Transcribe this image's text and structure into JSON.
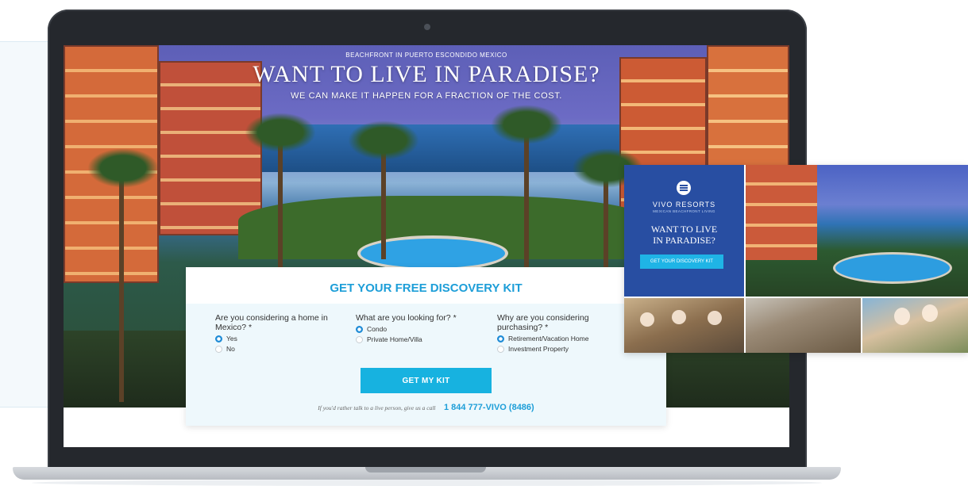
{
  "landing": {
    "hero": {
      "kicker": "BEACHFRONT IN PUERTO ESCONDIDO MEXICO",
      "title": "WANT TO LIVE IN PARADISE?",
      "subtitle": "WE CAN MAKE IT HAPPEN FOR A FRACTION OF THE COST."
    },
    "form": {
      "title": "GET YOUR FREE DISCOVERY KIT",
      "questions": [
        {
          "label": "Are you considering a home in Mexico? *",
          "options": [
            "Yes",
            "No"
          ],
          "selected": "Yes"
        },
        {
          "label": "What are you looking for? *",
          "options": [
            "Condo",
            "Private Home/Villa"
          ],
          "selected": "Condo"
        },
        {
          "label": "Why are you considering purchasing? *",
          "options": [
            "Retirement/Vacation Home",
            "Investment Property"
          ],
          "selected": "Retirement/Vacation Home"
        }
      ],
      "submit_label": "GET MY KIT",
      "call_text": "If you'd rather talk to a live person, give us a call",
      "phone": "1 844 777-VIVO (8486)"
    }
  },
  "ad": {
    "brand": "VIVO RESORTS",
    "brand_sub": "MEXICAN BEACHFRONT LIVING",
    "title_line1": "WANT TO LIVE",
    "title_line2": "IN PARADISE?",
    "button_label": "GET YOUR DISCOVERY KIT"
  },
  "colors": {
    "accent": "#1d9ed8",
    "button": "#17b2e0",
    "ad_blue": "#284ea2",
    "laptop": "#25282d"
  }
}
